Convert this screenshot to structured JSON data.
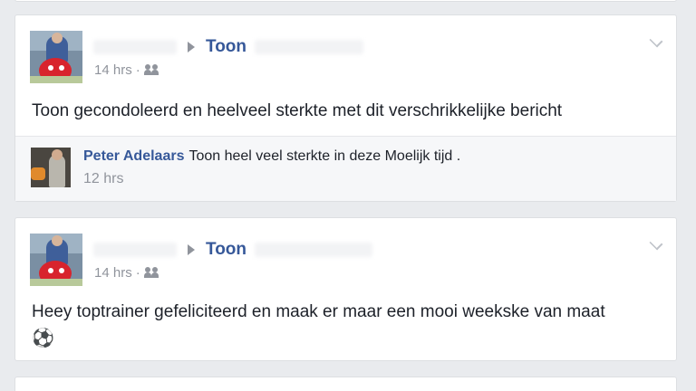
{
  "posts": [
    {
      "recipient": "Toon",
      "time": "14 hrs",
      "separator": "·",
      "audience_icon": "friends-icon",
      "text": "Toon gecondoleerd en heelveel sterkte met dit verschrikkelijke bericht",
      "comment": {
        "author": "Peter Adelaars",
        "text": "Toon heel veel sterkte in deze Moelijk tijd .",
        "time": "12 hrs"
      }
    },
    {
      "recipient": "Toon",
      "time": "14 hrs",
      "separator": "·",
      "audience_icon": "friends-icon",
      "text": "Heey toptrainer gefeliciteerd en maak er maar een mooi weekske van maat",
      "emoji": "⚽"
    }
  ],
  "colors": {
    "background": "#e9ebee",
    "card": "#ffffff",
    "link": "#365899",
    "meta": "#90949c",
    "comment_bg": "#f6f7f9"
  }
}
